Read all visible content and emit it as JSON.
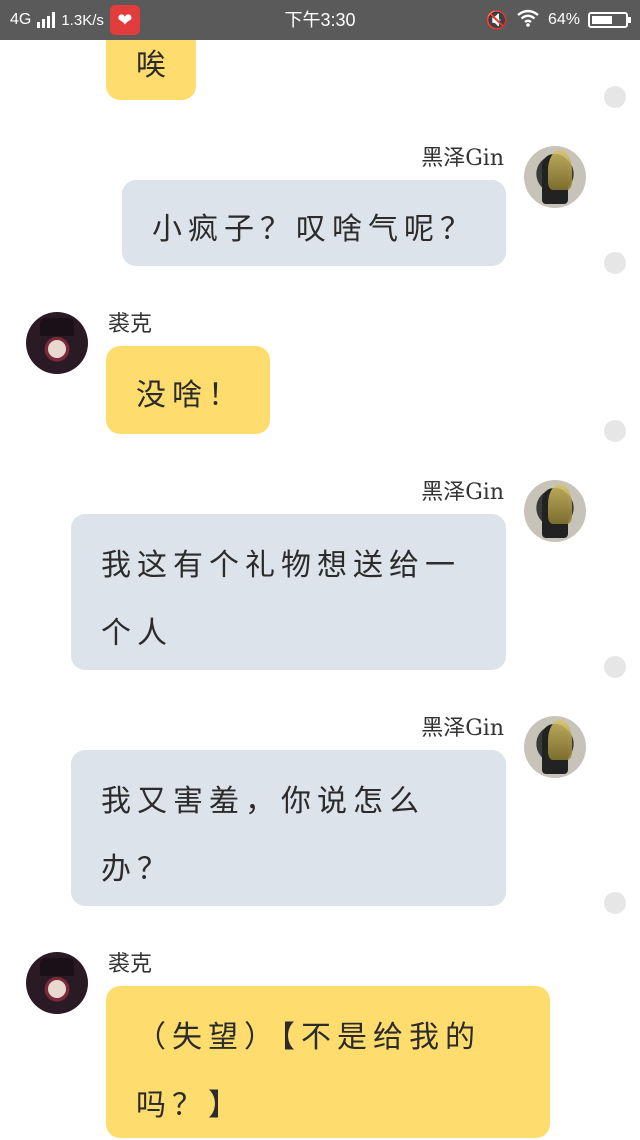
{
  "status_bar": {
    "network": "4G",
    "speed": "1.3K/s",
    "time": "下午3:30",
    "battery": "64%",
    "battery_level": 0.64,
    "icons": [
      "signal-icon",
      "app-notification-icon",
      "mute-icon",
      "wifi-icon",
      "battery-icon"
    ]
  },
  "chat": {
    "messages": [
      {
        "sender": "",
        "side": "left",
        "color": "yellow",
        "text": "唉"
      },
      {
        "sender": "黑泽Gin",
        "side": "right",
        "color": "blue",
        "text": "小疯子？叹啥气呢？"
      },
      {
        "sender": "裘克",
        "side": "left",
        "color": "yellow",
        "text": "没啥！"
      },
      {
        "sender": "黑泽Gin",
        "side": "right",
        "color": "blue",
        "text": "我这有个礼物想送给一个人"
      },
      {
        "sender": "黑泽Gin",
        "side": "right",
        "color": "blue",
        "text": "我又害羞，你说怎么办？"
      },
      {
        "sender": "裘克",
        "side": "left",
        "color": "yellow",
        "text": "（失望）【不是给我的吗？】"
      }
    ]
  },
  "colors": {
    "status_bar_bg": "#5a5a5a",
    "yellow_bubble": "#ffdc6e",
    "blue_bubble": "#dde3ea",
    "dot": "#e6e6e6"
  }
}
